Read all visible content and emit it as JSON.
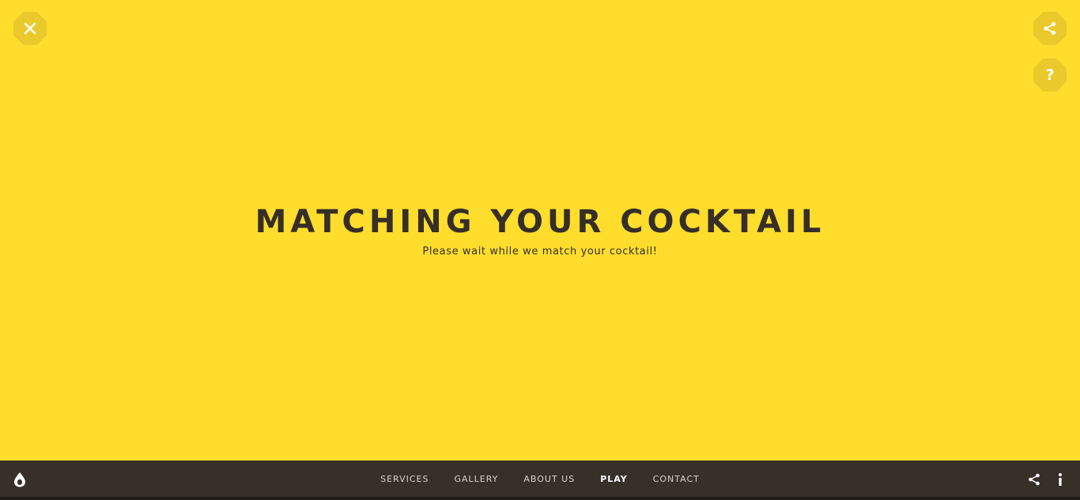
{
  "overlay": {
    "close_icon": "close-icon",
    "share_icon": "share-icon",
    "help_icon": "question-mark-icon",
    "help_glyph": "?",
    "background_color": "#ffdd2d",
    "button_color": "#e9c92b"
  },
  "main": {
    "title": "MATCHING YOUR COCKTAIL",
    "subtitle": "Please wait while we match your cocktail!"
  },
  "footer": {
    "logo_icon": "drop-logo-icon",
    "nav": [
      {
        "label": "SERVICES",
        "active": false
      },
      {
        "label": "GALLERY",
        "active": false
      },
      {
        "label": "ABOUT US",
        "active": false
      },
      {
        "label": "PLAY",
        "active": true
      },
      {
        "label": "CONTACT",
        "active": false
      }
    ],
    "share_icon": "share-icon",
    "info_icon": "info-icon",
    "background_color": "#363029"
  }
}
